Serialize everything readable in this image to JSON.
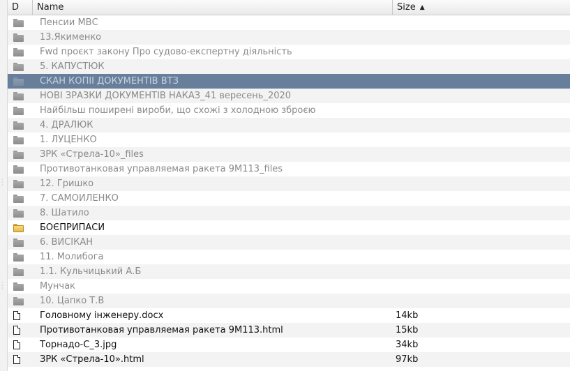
{
  "columns": {
    "d": "D",
    "name": "Name",
    "size": "Size"
  },
  "rows": [
    {
      "type": "folder",
      "name": "Пенсии МВС",
      "size": "",
      "style": "dim",
      "icon": "folder-gray"
    },
    {
      "type": "folder",
      "name": "13.Якименко",
      "size": "",
      "style": "dim",
      "icon": "folder-gray"
    },
    {
      "type": "folder",
      "name": "Fwd проєкт закону Про судово-експертну діяльність",
      "size": "",
      "style": "dim",
      "icon": "folder-gray"
    },
    {
      "type": "folder",
      "name": "5. КАПУСТЮК",
      "size": "",
      "style": "dim",
      "icon": "folder-gray"
    },
    {
      "type": "folder",
      "name": "СКАН КОПІЇ ДОКУМЕНТІВ ВТЗ",
      "size": "",
      "style": "selected",
      "icon": "folder-gray"
    },
    {
      "type": "folder",
      "name": "НОВІ ЗРАЗКИ ДОКУМЕНТІВ НАКАЗ_41 вересень_2020",
      "size": "",
      "style": "dim",
      "icon": "folder-gray"
    },
    {
      "type": "folder",
      "name": "Найбільш поширені вироби, що схожі з холодною зброєю",
      "size": "",
      "style": "dim",
      "icon": "folder-gray"
    },
    {
      "type": "folder",
      "name": "4. ДРАЛЮК",
      "size": "",
      "style": "dim",
      "icon": "folder-gray"
    },
    {
      "type": "folder",
      "name": "1. ЛУЦЕНКО",
      "size": "",
      "style": "dim",
      "icon": "folder-gray"
    },
    {
      "type": "folder",
      "name": "ЗРК «Стрела-10»_files",
      "size": "",
      "style": "dim",
      "icon": "folder-gray"
    },
    {
      "type": "folder",
      "name": "Противотанковая управляемая ракета 9М113_files",
      "size": "",
      "style": "dim",
      "icon": "folder-gray"
    },
    {
      "type": "folder",
      "name": "12. Гришко",
      "size": "",
      "style": "dim",
      "icon": "folder-gray"
    },
    {
      "type": "folder",
      "name": "7. САМОЙЛЕНКО",
      "size": "",
      "style": "dim",
      "icon": "folder-gray"
    },
    {
      "type": "folder",
      "name": "8. Шатило",
      "size": "",
      "style": "dim",
      "icon": "folder-gray"
    },
    {
      "type": "folder",
      "name": "БОЄПРИПАСИ",
      "size": "",
      "style": "normal",
      "icon": "folder-yellow"
    },
    {
      "type": "folder",
      "name": "6. ВИСІКАН",
      "size": "",
      "style": "dim",
      "icon": "folder-gray"
    },
    {
      "type": "folder",
      "name": "11. Молибога",
      "size": "",
      "style": "dim",
      "icon": "folder-gray"
    },
    {
      "type": "folder",
      "name": "1.1. Кульчицький А.Б",
      "size": "",
      "style": "dim",
      "icon": "folder-gray"
    },
    {
      "type": "folder",
      "name": "Мунчак",
      "size": "",
      "style": "dim",
      "icon": "folder-gray"
    },
    {
      "type": "folder",
      "name": "10. Цапко Т.В",
      "size": "",
      "style": "dim",
      "icon": "folder-gray"
    },
    {
      "type": "file",
      "name": "Головному інженеру.docx",
      "size": "14kb",
      "style": "normal",
      "icon": "file"
    },
    {
      "type": "file",
      "name": "Противотанковая управляемая ракета 9М113.html",
      "size": "15kb",
      "style": "normal",
      "icon": "file"
    },
    {
      "type": "file",
      "name": "Торнадо-С_3.jpg",
      "size": "34kb",
      "style": "normal",
      "icon": "file"
    },
    {
      "type": "file",
      "name": "ЗРК «Стрела-10».html",
      "size": "97kb",
      "style": "normal",
      "icon": "file"
    }
  ],
  "colors": {
    "selected_bg": "#687f9c",
    "alt_row_bg": "#f3f3f3",
    "dim_text": "#8a8a8a"
  }
}
